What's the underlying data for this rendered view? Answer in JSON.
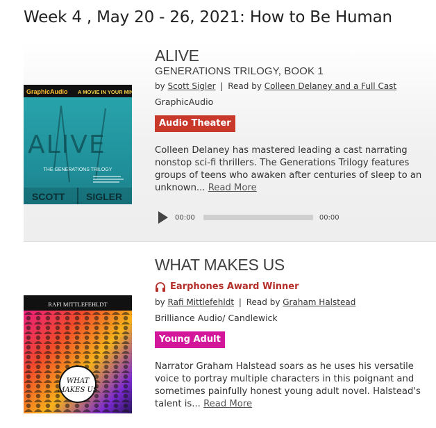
{
  "page": {
    "title": "Week 4 , May 20 - 26, 2021: How to Be Human"
  },
  "entries": [
    {
      "title": "ALIVE",
      "subtitle": "GENERATIONS TRILOGY, BOOK 1",
      "by_prefix": "by",
      "author": "Scott Sigler",
      "read_prefix": "Read by",
      "narrator": "Colleen Delaney and a Full Cast",
      "publisher": "GraphicAudio",
      "genre": "Audio Theater",
      "blurb": "Colleen Delaney has mastered leading a cast narrating nonstop sci-fi thrillers. The Generations Trilogy features groups of teens who awaken after centuries of sleep to an unknown...",
      "read_more": "Read More",
      "player": {
        "current": "00:00",
        "duration": "00:00",
        "progress": 0
      },
      "cover": {
        "brand": "GraphicAudio",
        "tagline": "A MOVIE IN YOUR MIND",
        "word": "ALIVE",
        "series": "THE GENERATIONS TRILOGY",
        "author_first": "SCOTT",
        "author_last": "SIGLER"
      }
    },
    {
      "title": "WHAT MAKES US",
      "award": "Earphones Award Winner",
      "by_prefix": "by",
      "author": "Rafi Mittlefehldt",
      "read_prefix": "Read by",
      "narrator": "Graham Halstead",
      "publisher": "Brilliance Audio/ Candlewick",
      "genre": "Young Adult",
      "blurb": "Narrator Graham Halstead soars as he uses his versatile voice to portray multiple characters in this poignant and sometimes painfully honest young adult novel. Halstead's talent is...",
      "read_more": "Read More",
      "cover": {
        "author": "RAFI MITTLEFEHLDT",
        "title_line1": "WHAT",
        "title_line2": "MAKES US"
      }
    }
  ],
  "colors": {
    "audio_theater": "#c8392b",
    "young_adult": "#d3179a",
    "award": "#b5302a"
  },
  "icons": {
    "award": "headphones-icon",
    "play": "play-icon"
  }
}
